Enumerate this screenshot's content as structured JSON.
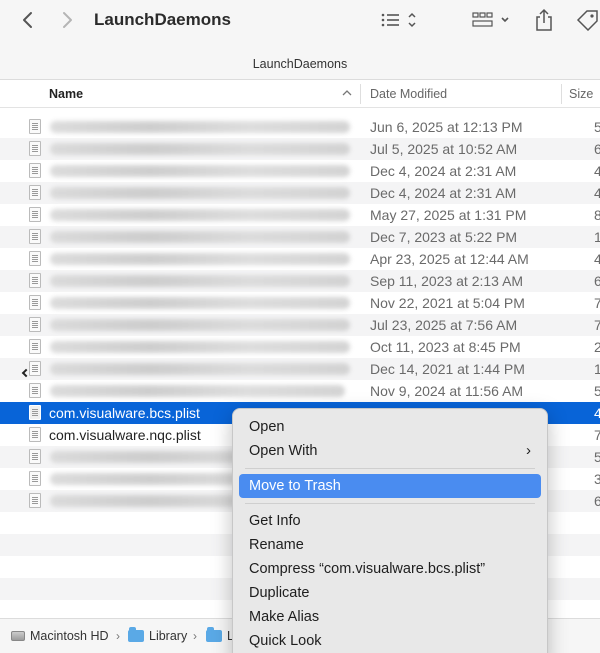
{
  "window": {
    "title": "LaunchDaemons",
    "subtitle": "LaunchDaemons"
  },
  "toolbar": {
    "back_icon": "chevron-left-icon",
    "forward_icon": "chevron-right-icon",
    "view_icon": "list-view-icon",
    "group_icon": "grid-group-icon",
    "share_icon": "share-icon",
    "tag_icon": "tag-icon"
  },
  "columns": {
    "name": "Name",
    "date": "Date Modified",
    "size": "Size"
  },
  "rows": [
    {
      "name": "",
      "date": "Jun 6, 2025 at 12:13 PM",
      "size": "5",
      "blurred": true
    },
    {
      "name": "",
      "date": "Jul 5, 2025 at 10:52 AM",
      "size": "6",
      "blurred": true
    },
    {
      "name": "",
      "date": "Dec 4, 2024 at 2:31 AM",
      "size": "4",
      "blurred": true
    },
    {
      "name": "",
      "date": "Dec 4, 2024 at 2:31 AM",
      "size": "4",
      "blurred": true
    },
    {
      "name": "",
      "date": "May 27, 2025 at 1:31 PM",
      "size": "8",
      "blurred": true
    },
    {
      "name": "",
      "date": "Dec 7, 2023 at 5:22 PM",
      "size": "1",
      "blurred": true
    },
    {
      "name": "",
      "date": "Apr 23, 2025 at 12:44 AM",
      "size": "4",
      "blurred": true
    },
    {
      "name": "",
      "date": "Sep 11, 2023 at 2:13 AM",
      "size": "6",
      "blurred": true
    },
    {
      "name": "",
      "date": "Nov 22, 2021 at 5:04 PM",
      "size": "7",
      "blurred": true
    },
    {
      "name": "",
      "date": "Jul 23, 2025 at 7:56 AM",
      "size": "7",
      "blurred": true
    },
    {
      "name": "",
      "date": "Oct 11, 2023 at 8:45 PM",
      "size": "2",
      "blurred": true
    },
    {
      "name": "",
      "date": "Dec 14, 2021 at 1:44 PM",
      "size": "1",
      "blurred": true
    },
    {
      "name": "",
      "date": "Nov 9, 2024 at 11:56 AM",
      "size": "5",
      "blurred": true
    },
    {
      "name": "com.visualware.bcs.plist",
      "date": "",
      "size": "4",
      "selected": true
    },
    {
      "name": "com.visualware.nqc.plist",
      "date": "",
      "size": "7"
    },
    {
      "name": "",
      "date": "",
      "size": "5",
      "blurred": true
    },
    {
      "name": "",
      "date": "",
      "size": "3",
      "blurred": true
    },
    {
      "name": "",
      "date": "",
      "size": "6",
      "blurred": true
    }
  ],
  "pathbar": {
    "items": [
      "Macintosh HD",
      "Library",
      "L"
    ]
  },
  "context_menu": {
    "items": [
      {
        "label": "Open"
      },
      {
        "label": "Open With",
        "submenu": true
      },
      {
        "sep": true
      },
      {
        "label": "Move to Trash",
        "highlighted": true
      },
      {
        "sep": true
      },
      {
        "label": "Get Info"
      },
      {
        "label": "Rename"
      },
      {
        "label": "Compress “com.visualware.bcs.plist”"
      },
      {
        "label": "Duplicate"
      },
      {
        "label": "Make Alias"
      },
      {
        "label": "Quick Look"
      }
    ]
  }
}
